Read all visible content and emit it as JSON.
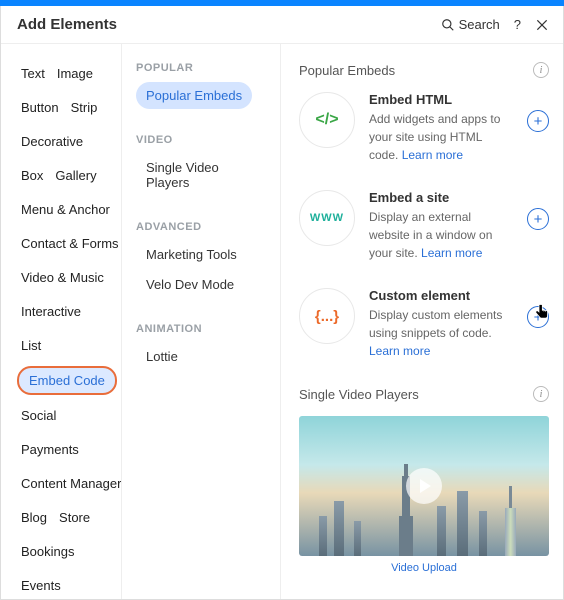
{
  "header": {
    "title": "Add Elements",
    "search_label": "Search"
  },
  "sidebar": {
    "items": [
      "Text",
      "Image",
      "Button",
      "Strip",
      "Decorative",
      "Box",
      "Gallery",
      "Menu & Anchor",
      "Contact & Forms",
      "Video & Music",
      "Interactive",
      "List",
      "Embed Code",
      "Social",
      "Payments",
      "Content Manager",
      "Blog",
      "Store",
      "Bookings",
      "Events"
    ],
    "selected_index": 12
  },
  "middle": {
    "groups": [
      {
        "heading": "Popular",
        "items": [
          "Popular Embeds"
        ],
        "active_index": 0
      },
      {
        "heading": "Video",
        "items": [
          "Single Video Players"
        ]
      },
      {
        "heading": "Advanced",
        "items": [
          "Marketing Tools",
          "Velo Dev Mode"
        ]
      },
      {
        "heading": "Animation",
        "items": [
          "Lottie"
        ]
      }
    ]
  },
  "content": {
    "section1_title": "Popular Embeds",
    "embeds": [
      {
        "icon_text": "</>",
        "icon_class": "c-green",
        "title": "Embed HTML",
        "desc": "Add widgets and apps to your site using HTML code.",
        "learn": "Learn more"
      },
      {
        "icon_text": "WWW",
        "icon_class": "c-teal",
        "title": "Embed a site",
        "desc": "Display an external website in a window on your site.",
        "learn": "Learn more"
      },
      {
        "icon_text": "{...}",
        "icon_class": "c-orange",
        "title": "Custom element",
        "desc": "Display custom elements using snippets of code.",
        "learn": "Learn more"
      }
    ],
    "section2_title": "Single Video Players",
    "video_caption": "Video Upload"
  }
}
